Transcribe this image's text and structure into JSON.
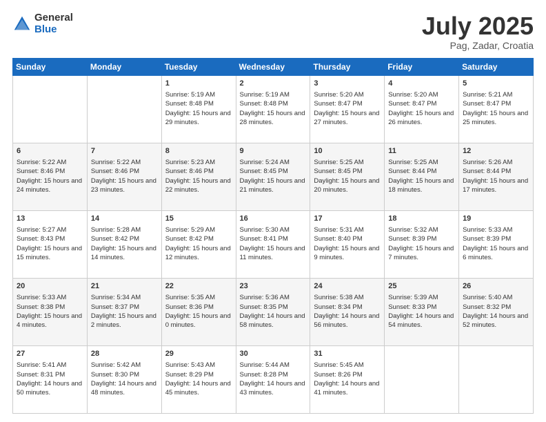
{
  "logo": {
    "general": "General",
    "blue": "Blue"
  },
  "title": "July 2025",
  "location": "Pag, Zadar, Croatia",
  "weekdays": [
    "Sunday",
    "Monday",
    "Tuesday",
    "Wednesday",
    "Thursday",
    "Friday",
    "Saturday"
  ],
  "weeks": [
    [
      {
        "day": "",
        "sunrise": "",
        "sunset": "",
        "daylight": ""
      },
      {
        "day": "",
        "sunrise": "",
        "sunset": "",
        "daylight": ""
      },
      {
        "day": "1",
        "sunrise": "Sunrise: 5:19 AM",
        "sunset": "Sunset: 8:48 PM",
        "daylight": "Daylight: 15 hours and 29 minutes."
      },
      {
        "day": "2",
        "sunrise": "Sunrise: 5:19 AM",
        "sunset": "Sunset: 8:48 PM",
        "daylight": "Daylight: 15 hours and 28 minutes."
      },
      {
        "day": "3",
        "sunrise": "Sunrise: 5:20 AM",
        "sunset": "Sunset: 8:47 PM",
        "daylight": "Daylight: 15 hours and 27 minutes."
      },
      {
        "day": "4",
        "sunrise": "Sunrise: 5:20 AM",
        "sunset": "Sunset: 8:47 PM",
        "daylight": "Daylight: 15 hours and 26 minutes."
      },
      {
        "day": "5",
        "sunrise": "Sunrise: 5:21 AM",
        "sunset": "Sunset: 8:47 PM",
        "daylight": "Daylight: 15 hours and 25 minutes."
      }
    ],
    [
      {
        "day": "6",
        "sunrise": "Sunrise: 5:22 AM",
        "sunset": "Sunset: 8:46 PM",
        "daylight": "Daylight: 15 hours and 24 minutes."
      },
      {
        "day": "7",
        "sunrise": "Sunrise: 5:22 AM",
        "sunset": "Sunset: 8:46 PM",
        "daylight": "Daylight: 15 hours and 23 minutes."
      },
      {
        "day": "8",
        "sunrise": "Sunrise: 5:23 AM",
        "sunset": "Sunset: 8:46 PM",
        "daylight": "Daylight: 15 hours and 22 minutes."
      },
      {
        "day": "9",
        "sunrise": "Sunrise: 5:24 AM",
        "sunset": "Sunset: 8:45 PM",
        "daylight": "Daylight: 15 hours and 21 minutes."
      },
      {
        "day": "10",
        "sunrise": "Sunrise: 5:25 AM",
        "sunset": "Sunset: 8:45 PM",
        "daylight": "Daylight: 15 hours and 20 minutes."
      },
      {
        "day": "11",
        "sunrise": "Sunrise: 5:25 AM",
        "sunset": "Sunset: 8:44 PM",
        "daylight": "Daylight: 15 hours and 18 minutes."
      },
      {
        "day": "12",
        "sunrise": "Sunrise: 5:26 AM",
        "sunset": "Sunset: 8:44 PM",
        "daylight": "Daylight: 15 hours and 17 minutes."
      }
    ],
    [
      {
        "day": "13",
        "sunrise": "Sunrise: 5:27 AM",
        "sunset": "Sunset: 8:43 PM",
        "daylight": "Daylight: 15 hours and 15 minutes."
      },
      {
        "day": "14",
        "sunrise": "Sunrise: 5:28 AM",
        "sunset": "Sunset: 8:42 PM",
        "daylight": "Daylight: 15 hours and 14 minutes."
      },
      {
        "day": "15",
        "sunrise": "Sunrise: 5:29 AM",
        "sunset": "Sunset: 8:42 PM",
        "daylight": "Daylight: 15 hours and 12 minutes."
      },
      {
        "day": "16",
        "sunrise": "Sunrise: 5:30 AM",
        "sunset": "Sunset: 8:41 PM",
        "daylight": "Daylight: 15 hours and 11 minutes."
      },
      {
        "day": "17",
        "sunrise": "Sunrise: 5:31 AM",
        "sunset": "Sunset: 8:40 PM",
        "daylight": "Daylight: 15 hours and 9 minutes."
      },
      {
        "day": "18",
        "sunrise": "Sunrise: 5:32 AM",
        "sunset": "Sunset: 8:39 PM",
        "daylight": "Daylight: 15 hours and 7 minutes."
      },
      {
        "day": "19",
        "sunrise": "Sunrise: 5:33 AM",
        "sunset": "Sunset: 8:39 PM",
        "daylight": "Daylight: 15 hours and 6 minutes."
      }
    ],
    [
      {
        "day": "20",
        "sunrise": "Sunrise: 5:33 AM",
        "sunset": "Sunset: 8:38 PM",
        "daylight": "Daylight: 15 hours and 4 minutes."
      },
      {
        "day": "21",
        "sunrise": "Sunrise: 5:34 AM",
        "sunset": "Sunset: 8:37 PM",
        "daylight": "Daylight: 15 hours and 2 minutes."
      },
      {
        "day": "22",
        "sunrise": "Sunrise: 5:35 AM",
        "sunset": "Sunset: 8:36 PM",
        "daylight": "Daylight: 15 hours and 0 minutes."
      },
      {
        "day": "23",
        "sunrise": "Sunrise: 5:36 AM",
        "sunset": "Sunset: 8:35 PM",
        "daylight": "Daylight: 14 hours and 58 minutes."
      },
      {
        "day": "24",
        "sunrise": "Sunrise: 5:38 AM",
        "sunset": "Sunset: 8:34 PM",
        "daylight": "Daylight: 14 hours and 56 minutes."
      },
      {
        "day": "25",
        "sunrise": "Sunrise: 5:39 AM",
        "sunset": "Sunset: 8:33 PM",
        "daylight": "Daylight: 14 hours and 54 minutes."
      },
      {
        "day": "26",
        "sunrise": "Sunrise: 5:40 AM",
        "sunset": "Sunset: 8:32 PM",
        "daylight": "Daylight: 14 hours and 52 minutes."
      }
    ],
    [
      {
        "day": "27",
        "sunrise": "Sunrise: 5:41 AM",
        "sunset": "Sunset: 8:31 PM",
        "daylight": "Daylight: 14 hours and 50 minutes."
      },
      {
        "day": "28",
        "sunrise": "Sunrise: 5:42 AM",
        "sunset": "Sunset: 8:30 PM",
        "daylight": "Daylight: 14 hours and 48 minutes."
      },
      {
        "day": "29",
        "sunrise": "Sunrise: 5:43 AM",
        "sunset": "Sunset: 8:29 PM",
        "daylight": "Daylight: 14 hours and 45 minutes."
      },
      {
        "day": "30",
        "sunrise": "Sunrise: 5:44 AM",
        "sunset": "Sunset: 8:28 PM",
        "daylight": "Daylight: 14 hours and 43 minutes."
      },
      {
        "day": "31",
        "sunrise": "Sunrise: 5:45 AM",
        "sunset": "Sunset: 8:26 PM",
        "daylight": "Daylight: 14 hours and 41 minutes."
      },
      {
        "day": "",
        "sunrise": "",
        "sunset": "",
        "daylight": ""
      },
      {
        "day": "",
        "sunrise": "",
        "sunset": "",
        "daylight": ""
      }
    ]
  ]
}
